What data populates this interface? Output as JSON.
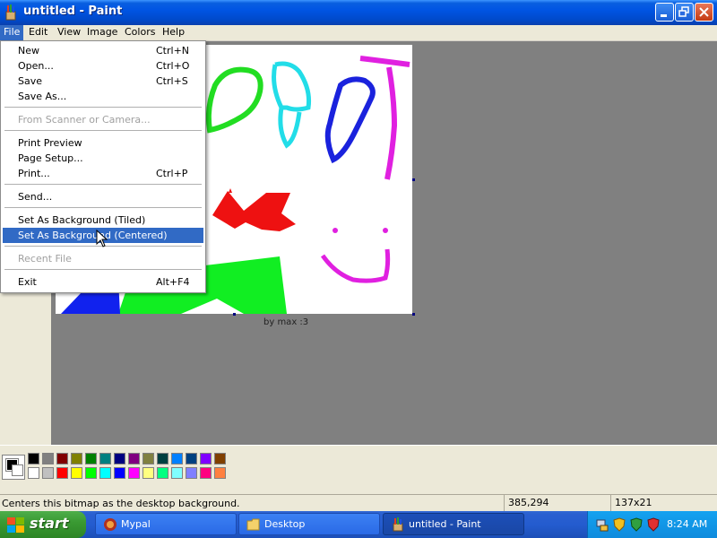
{
  "window": {
    "title": "untitled - Paint",
    "icon": "paint-icon"
  },
  "menubar": {
    "items": [
      "File",
      "Edit",
      "View",
      "Image",
      "Colors",
      "Help"
    ],
    "active": "File"
  },
  "file_menu": {
    "items": [
      {
        "label": "New",
        "shortcut": "Ctrl+N",
        "enabled": true
      },
      {
        "label": "Open...",
        "shortcut": "Ctrl+O",
        "enabled": true
      },
      {
        "label": "Save",
        "shortcut": "Ctrl+S",
        "enabled": true
      },
      {
        "label": "Save As...",
        "shortcut": "",
        "enabled": true
      },
      {
        "label": "From Scanner or Camera...",
        "shortcut": "",
        "enabled": false
      },
      {
        "label": "Print Preview",
        "shortcut": "",
        "enabled": true
      },
      {
        "label": "Page Setup...",
        "shortcut": "",
        "enabled": true
      },
      {
        "label": "Print...",
        "shortcut": "Ctrl+P",
        "enabled": true
      },
      {
        "label": "Send...",
        "shortcut": "",
        "enabled": true
      },
      {
        "label": "Set As Background (Tiled)",
        "shortcut": "",
        "enabled": true
      },
      {
        "label": "Set As Background (Centered)",
        "shortcut": "",
        "enabled": true,
        "highlighted": true
      },
      {
        "label": "Recent File",
        "shortcut": "",
        "enabled": false
      },
      {
        "label": "Exit",
        "shortcut": "Alt+F4",
        "enabled": true
      }
    ]
  },
  "canvas": {
    "visible_text": "by max :3"
  },
  "palette": {
    "foreground": "#000000",
    "background": "#ffffff",
    "colors": [
      "#000000",
      "#808080",
      "#800000",
      "#808000",
      "#008000",
      "#008080",
      "#000080",
      "#800080",
      "#808040",
      "#004040",
      "#0080ff",
      "#004080",
      "#8000ff",
      "#804000",
      "#ffffff",
      "#c0c0c0",
      "#ff0000",
      "#ffff00",
      "#00ff00",
      "#00ffff",
      "#0000ff",
      "#ff00ff",
      "#ffff80",
      "#00ff80",
      "#80ffff",
      "#8080ff",
      "#ff0080",
      "#ff8040"
    ]
  },
  "statusbar": {
    "help": "Centers this bitmap as the desktop background.",
    "coords": "385,294",
    "size": "137x21"
  },
  "taskbar": {
    "start": "start",
    "tasks": [
      {
        "label": "Mypal",
        "icon": "mypal-icon",
        "active": false
      },
      {
        "label": "Desktop",
        "icon": "folder-icon",
        "active": false
      },
      {
        "label": "untitled - Paint",
        "icon": "paint-icon",
        "active": true
      }
    ],
    "tray_icons": [
      "network-icon",
      "security-shield-icon",
      "update-icon",
      "antivirus-icon"
    ],
    "clock": "8:24 AM"
  }
}
